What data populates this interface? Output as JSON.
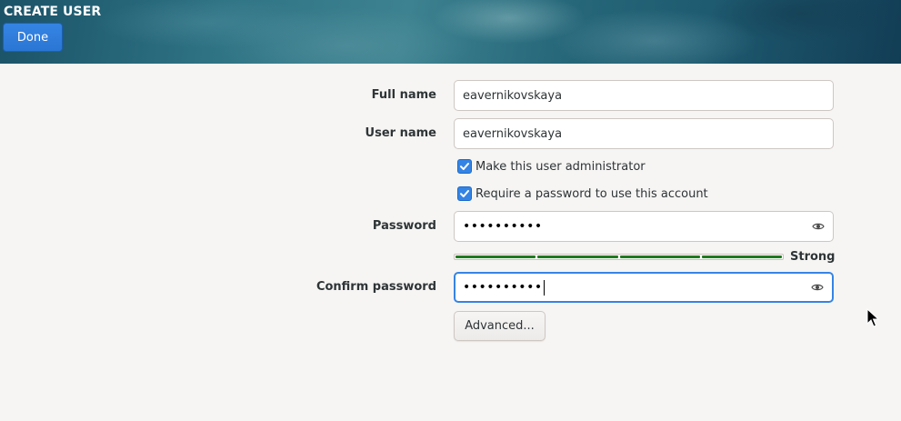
{
  "header": {
    "title": "CREATE USER",
    "done_label": "Done"
  },
  "form": {
    "full_name_label": "Full name",
    "full_name_value": "eavernikovskaya",
    "user_name_label": "User name",
    "user_name_value": "eavernikovskaya",
    "admin_checkbox": {
      "label": "Make this user administrator",
      "checked": true
    },
    "require_password_checkbox": {
      "label": "Require a password to use this account",
      "checked": true
    },
    "password_label": "Password",
    "password_value": "••••••••••",
    "strength": {
      "segments_filled": 4,
      "segments_total": 4,
      "label": "Strong"
    },
    "confirm_password_label": "Confirm password",
    "confirm_password_value": "••••••••••",
    "advanced_label": "Advanced..."
  },
  "icons": {
    "reveal": "eye-icon",
    "check": "checkmark-icon",
    "pointer": "mouse-cursor-icon"
  },
  "colors": {
    "accent": "#3584e4",
    "strength_bar": "#1f7a1f",
    "background": "#f6f5f4"
  }
}
